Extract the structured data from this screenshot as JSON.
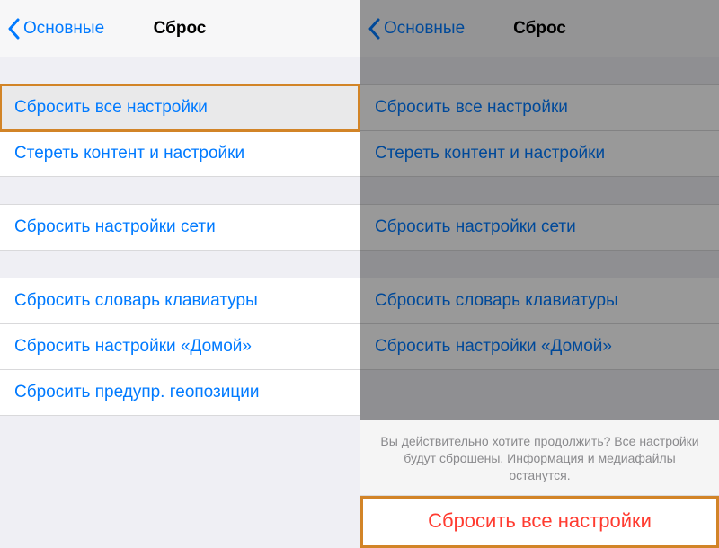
{
  "navbar": {
    "back_label": "Основные",
    "title": "Сброс"
  },
  "cells": {
    "reset_all_settings": "Сбросить все настройки",
    "erase_content": "Стереть контент и настройки",
    "reset_network": "Сбросить настройки сети",
    "reset_keyboard": "Сбросить словарь клавиатуры",
    "reset_home": "Сбросить настройки «Домой»",
    "reset_location": "Сбросить предупр. геопозиции"
  },
  "action_sheet": {
    "message": "Вы действительно хотите продолжить? Все настройки будут сброшены. Информация и медиафайлы останутся.",
    "confirm": "Сбросить все настройки"
  },
  "colors": {
    "link": "#007aff",
    "destructive": "#ff3b30",
    "highlight_border": "#d28427"
  }
}
